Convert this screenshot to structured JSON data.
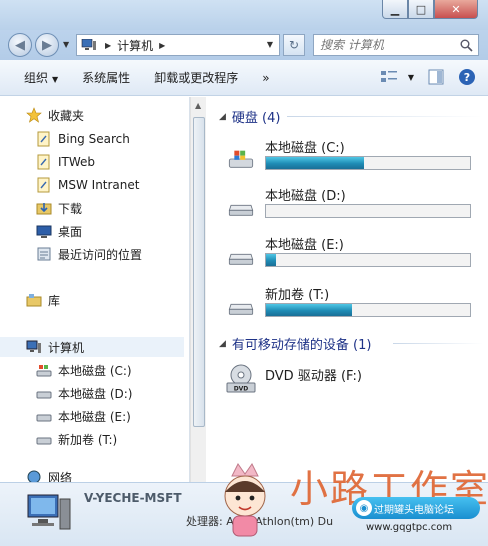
{
  "window": {
    "minimize": "▁",
    "maximize": "□",
    "close": "✕"
  },
  "navbar": {
    "back": "◀",
    "forward": "▶",
    "crumb": "计算机",
    "search_placeholder": "搜索 计算机"
  },
  "toolbar": {
    "organize": "组织",
    "system_properties": "系统属性",
    "uninstall": "卸载或更改程序",
    "more": "»"
  },
  "nav": {
    "favorites": "收藏夹",
    "favorites_items": [
      "Bing Search",
      "ITWeb",
      "MSW Intranet",
      "下载",
      "桌面",
      "最近访问的位置"
    ],
    "libraries": "库",
    "computer": "计算机",
    "computer_items": [
      "本地磁盘 (C:)",
      "本地磁盘 (D:)",
      "本地磁盘 (E:)",
      "新加卷 (T:)"
    ],
    "network": "网络"
  },
  "content": {
    "hard_disks_header": "硬盘 (4)",
    "drives": [
      {
        "name": "本地磁盘 (C:)",
        "used_fraction": 0.48
      },
      {
        "name": "本地磁盘 (D:)",
        "used_fraction": 0.0
      },
      {
        "name": "本地磁盘 (E:)",
        "used_fraction": 0.05
      },
      {
        "name": "新加卷 (T:)",
        "used_fraction": 0.42
      }
    ],
    "removable_header": "有可移动存储的设备 (1)",
    "removable": [
      {
        "name": "DVD 驱动器 (F:)"
      }
    ]
  },
  "details": {
    "computer_name": "V-YECHE-MSFT",
    "processor": "处理器: AMD Athlon(tm) Du"
  },
  "watermark": {
    "title": "小路工作室",
    "badge": "过期罐头电脑论坛",
    "url": "www.gqgtpc.com"
  },
  "colors": {
    "drive_bar": "#1f8cb5",
    "group_header": "#1e3287",
    "watermark": "#e06b3a"
  }
}
